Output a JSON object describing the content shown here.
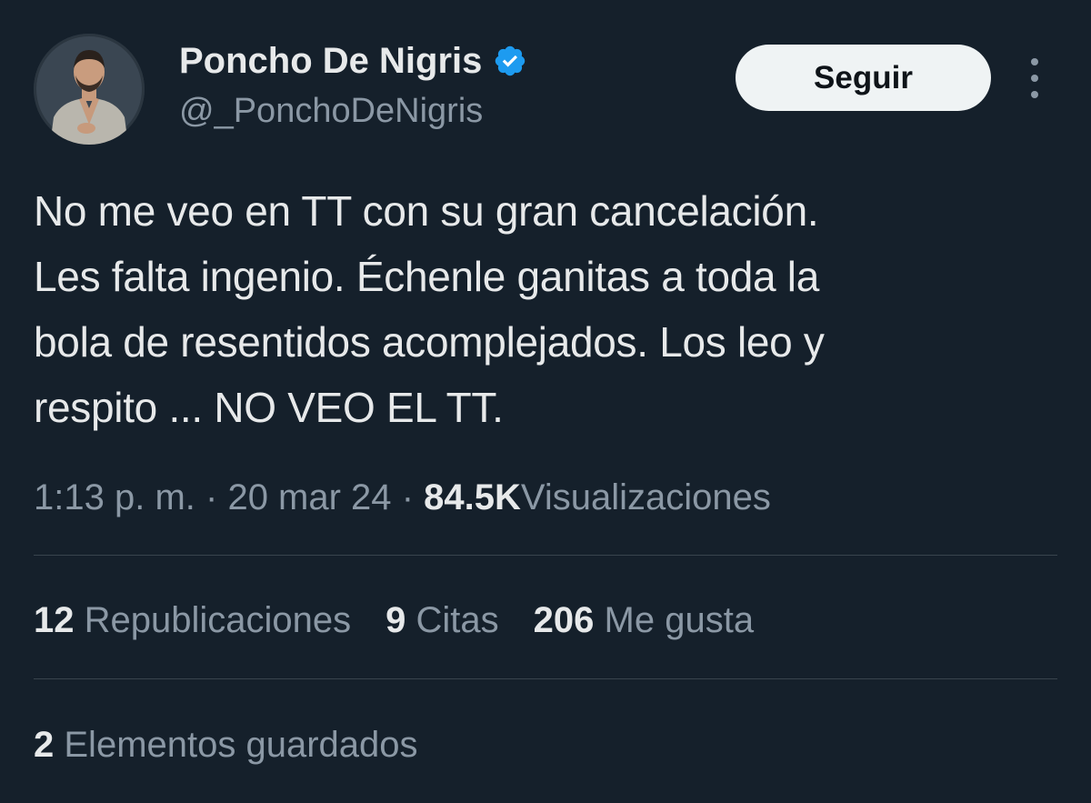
{
  "author": {
    "display_name": "Poncho De Nigris",
    "handle": "@_PonchoDeNigris",
    "verified_color": "#1d9bf0"
  },
  "actions": {
    "follow_label": "Seguir",
    "more_icon": "more-vertical-icon"
  },
  "tweet": {
    "text": "No me veo en TT con su gran cancelación.\nLes falta ingenio. Échenle ganitas a toda la\nbola de resentidos acomplejados. Los leo y\nrespito ... NO VEO EL TT."
  },
  "meta": {
    "time": "1:13 p. m.",
    "separator": "·",
    "date": "20 mar 24",
    "views_count": "84.5K",
    "views_label": "Visualizaciones"
  },
  "stats": [
    {
      "count": "12",
      "label": "Republicaciones"
    },
    {
      "count": "9",
      "label": "Citas"
    },
    {
      "count": "206",
      "label": "Me gusta"
    }
  ],
  "bookmarks": {
    "count": "2",
    "label": "Elementos guardados"
  }
}
